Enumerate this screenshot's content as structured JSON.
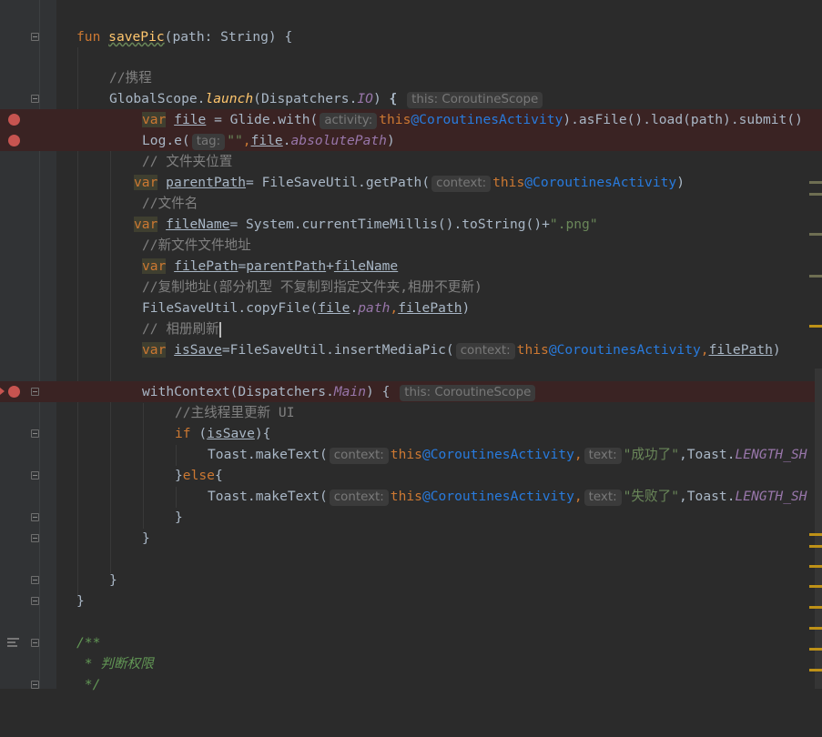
{
  "editor": {
    "lines": {
      "fun_sig": {
        "kw": "fun ",
        "name": "savePic",
        "params": "(path: String) {"
      },
      "comment_ctx": "//携程",
      "launch": {
        "obj": "GlobalScope.",
        "fn": "launch",
        "args": "(Dispatchers.",
        "io": "IO",
        "close": ") ",
        "brace": "{",
        "hint": "this: CoroutineScope"
      },
      "file_line": {
        "kw": "var",
        "name": "file",
        "mid": " = Glide.with(",
        "hint": "activity:",
        "kw2": "this",
        "label": "@CoroutinesActivity",
        "rest": ").asFile().load(path).submit()"
      },
      "log_line": {
        "pre": "Log.e(",
        "hint": "tag:",
        "str": "\"\"",
        "comma": ",",
        "file": "file",
        "dot": ".",
        "prop": "absolutePath",
        "close": ")"
      },
      "comment_folder": "// 文件夹位置",
      "parent_line": {
        "kw": "var",
        "name": "parentPath",
        "mid": "= FileSaveUtil.getPath(",
        "hint": "context:",
        "kw2": "this",
        "label": "@CoroutinesActivity",
        "close": ")"
      },
      "comment_filename": "//文件名",
      "filename_line": {
        "kw": "var",
        "name": "fileName",
        "mid": "= System.currentTimeMillis().toString()+",
        "str": "\".png\""
      },
      "comment_newpath": "//新文件文件地址",
      "filepath_line": {
        "kw": "var",
        "name": "filePath",
        "eq": "=",
        "a": "parentPath",
        "plus": "+",
        "b": "fileName"
      },
      "comment_copy": "//复制地址(部分机型 不复制到指定文件夹,相册不更新)",
      "copy_line": {
        "pre": "FileSaveUtil.copyFile(",
        "file": "file",
        "dot": ".",
        "prop": "path",
        "comma": ",",
        "arg": "filePath",
        "close": ")"
      },
      "comment_refresh": "// 相册刷新",
      "issave_line": {
        "kw": "var",
        "name": "isSave",
        "mid": "=FileSaveUtil.insertMediaPic(",
        "hint": "context:",
        "kw2": "this",
        "label": "@CoroutinesActivity",
        "comma": ",",
        "arg": "filePath",
        "close": ")"
      },
      "withcontext": {
        "pre": "withContext(Dispatchers.",
        "main": "Main",
        "close": ") {",
        "hint": "this: CoroutineScope"
      },
      "comment_ui": "//主线程里更新 UI",
      "if_line": {
        "kw": "if",
        "open": " (",
        "var": "isSave",
        "close": "){"
      },
      "toast_ok": {
        "pre": "Toast.makeText(",
        "hint": "context:",
        "kw2": "this",
        "label": "@CoroutinesActivity",
        "comma": ",",
        "hint2": "text:",
        "str": "\"成功了\"",
        "rest": ",Toast.",
        "const": "LENGTH_SH"
      },
      "else_line": {
        "pre": "}",
        "kw": "else",
        "post": "{"
      },
      "toast_fail": {
        "pre": "Toast.makeText(",
        "hint": "context:",
        "kw2": "this",
        "label": "@CoroutinesActivity",
        "comma": ",",
        "hint2": "text:",
        "str": "\"失败了\"",
        "rest": ",Toast.",
        "const": "LENGTH_SH"
      },
      "brace": "}",
      "doc_open": "/**",
      "doc_text": " * 判断权限",
      "doc_close": " */"
    }
  },
  "colors": {
    "background": "#2b2b2b",
    "gutter": "#313335",
    "breakpoint": "#c75450",
    "keyword": "#cc7832",
    "function": "#ffc66d",
    "string": "#6a8759",
    "comment": "#808080",
    "field": "#9876aa",
    "label": "#287bde",
    "error_marker": "#be9117"
  },
  "icons": [
    "breakpoint-icon",
    "fold-icon",
    "execution-arrow-icon",
    "collapsed-lines-icon"
  ]
}
